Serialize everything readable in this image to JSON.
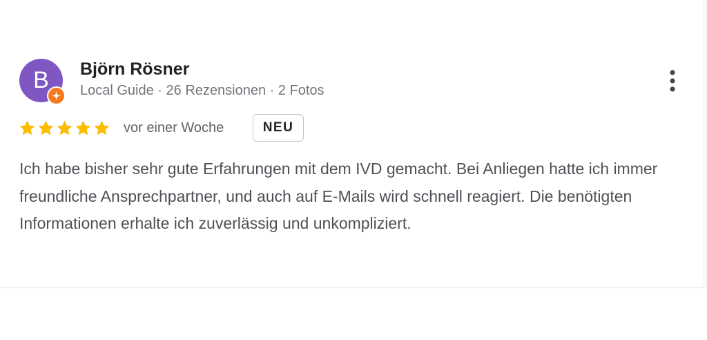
{
  "reviewer": {
    "initial": "B",
    "name": "Björn Rösner",
    "meta": "Local Guide · 26 Rezensionen · 2 Fotos",
    "avatar_color": "#7e57c2",
    "guide_badge_color": "#f4791f",
    "guide_badge_icon": "star-burst-icon"
  },
  "menu": {
    "icon": "more-vert-icon"
  },
  "review": {
    "rating": 5,
    "max_rating": 5,
    "star_color": "#fbbc04",
    "date": "vor einer Woche",
    "badge": "NEU",
    "text": "Ich habe bisher sehr gute Erfahrungen mit dem IVD gemacht. Bei Anliegen hatte ich immer freundliche Ansprechpartner, und auch auf E-Mails wird schnell reagiert. Die benötigten Informationen erhalte ich zuverlässig und unkompliziert."
  }
}
